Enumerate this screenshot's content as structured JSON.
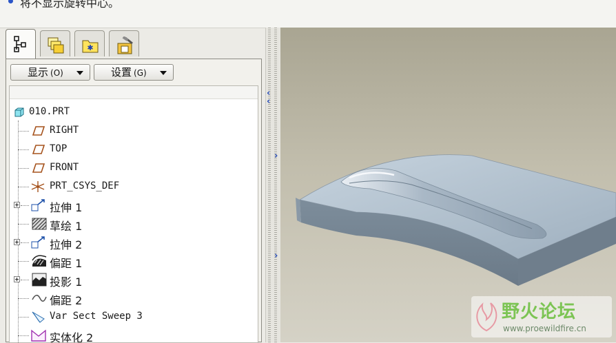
{
  "status": {
    "message": "将不显示旋转中心。"
  },
  "panel": {
    "tabs": [
      {
        "name": "model-tree",
        "active": true
      },
      {
        "name": "folder-browser",
        "active": false
      },
      {
        "name": "favorites",
        "active": false
      },
      {
        "name": "connections",
        "active": false
      }
    ],
    "show_label": "显示",
    "show_key": "(O)",
    "settings_label": "设置",
    "settings_key": "(G)"
  },
  "tree": {
    "root": "010.PRT",
    "items": [
      {
        "label": "RIGHT",
        "icon": "datum-plane-icon",
        "expandable": false
      },
      {
        "label": "TOP",
        "icon": "datum-plane-icon",
        "expandable": false
      },
      {
        "label": "FRONT",
        "icon": "datum-plane-icon",
        "expandable": false
      },
      {
        "label": "PRT_CSYS_DEF",
        "icon": "coordinate-system-icon",
        "expandable": false
      },
      {
        "label": "拉伸 1",
        "icon": "extrude-icon",
        "expandable": true
      },
      {
        "label": "草绘 1",
        "icon": "sketch-icon",
        "expandable": false
      },
      {
        "label": "拉伸 2",
        "icon": "extrude-icon",
        "expandable": true
      },
      {
        "label": "偏距 1",
        "icon": "offset-icon",
        "expandable": false
      },
      {
        "label": "投影 1",
        "icon": "projection-icon",
        "expandable": true
      },
      {
        "label": "偏距 2",
        "icon": "offset-curve-icon",
        "expandable": false
      },
      {
        "label": "Var Sect Sweep 3",
        "icon": "var-sect-sweep-icon",
        "expandable": false
      },
      {
        "label": "实体化 2",
        "icon": "solidify-icon",
        "expandable": false
      }
    ]
  },
  "watermark": {
    "name": "野火论坛",
    "url": "www.proewildfire.cn"
  }
}
